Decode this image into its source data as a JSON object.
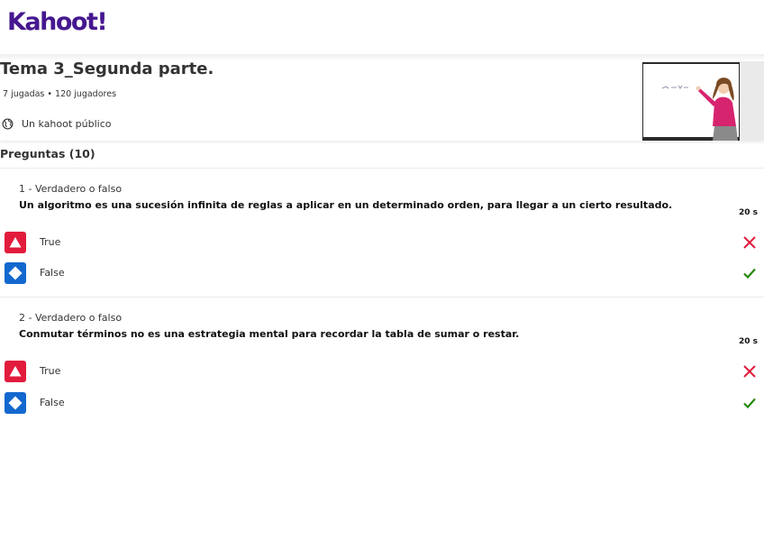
{
  "brand": {
    "logo_text": "Kahoot!",
    "color": "#46178f"
  },
  "kahoot": {
    "title": "Tema 3_Segunda parte.",
    "stats": "7 jugadas • 120 jugadores",
    "visibility": "Un kahoot público"
  },
  "questions_section": {
    "title": "Preguntas (10)"
  },
  "questions": [
    {
      "type_label": "1 - Verdadero o falso",
      "text": "Un algoritmo es una sucesión infinita de reglas a aplicar en un determinado orden, para llegar a un cierto resultado.",
      "time": "20 s",
      "answers": [
        {
          "label": "True",
          "shape": "triangle-icon",
          "color": "#e21b3c",
          "correct": false
        },
        {
          "label": "False",
          "shape": "diamond-icon",
          "color": "#1368ce",
          "correct": true
        }
      ]
    },
    {
      "type_label": "2 - Verdadero o falso",
      "text": "Conmutar términos no es una estrategia mental para recordar la tabla de sumar o restar.",
      "time": "20 s",
      "answers": [
        {
          "label": "True",
          "shape": "triangle-icon",
          "color": "#e21b3c",
          "correct": false
        },
        {
          "label": "False",
          "shape": "diamond-icon",
          "color": "#1368ce",
          "correct": true
        }
      ]
    }
  ],
  "status_colors": {
    "correct": "#26890c",
    "incorrect": "#e21b3c"
  }
}
